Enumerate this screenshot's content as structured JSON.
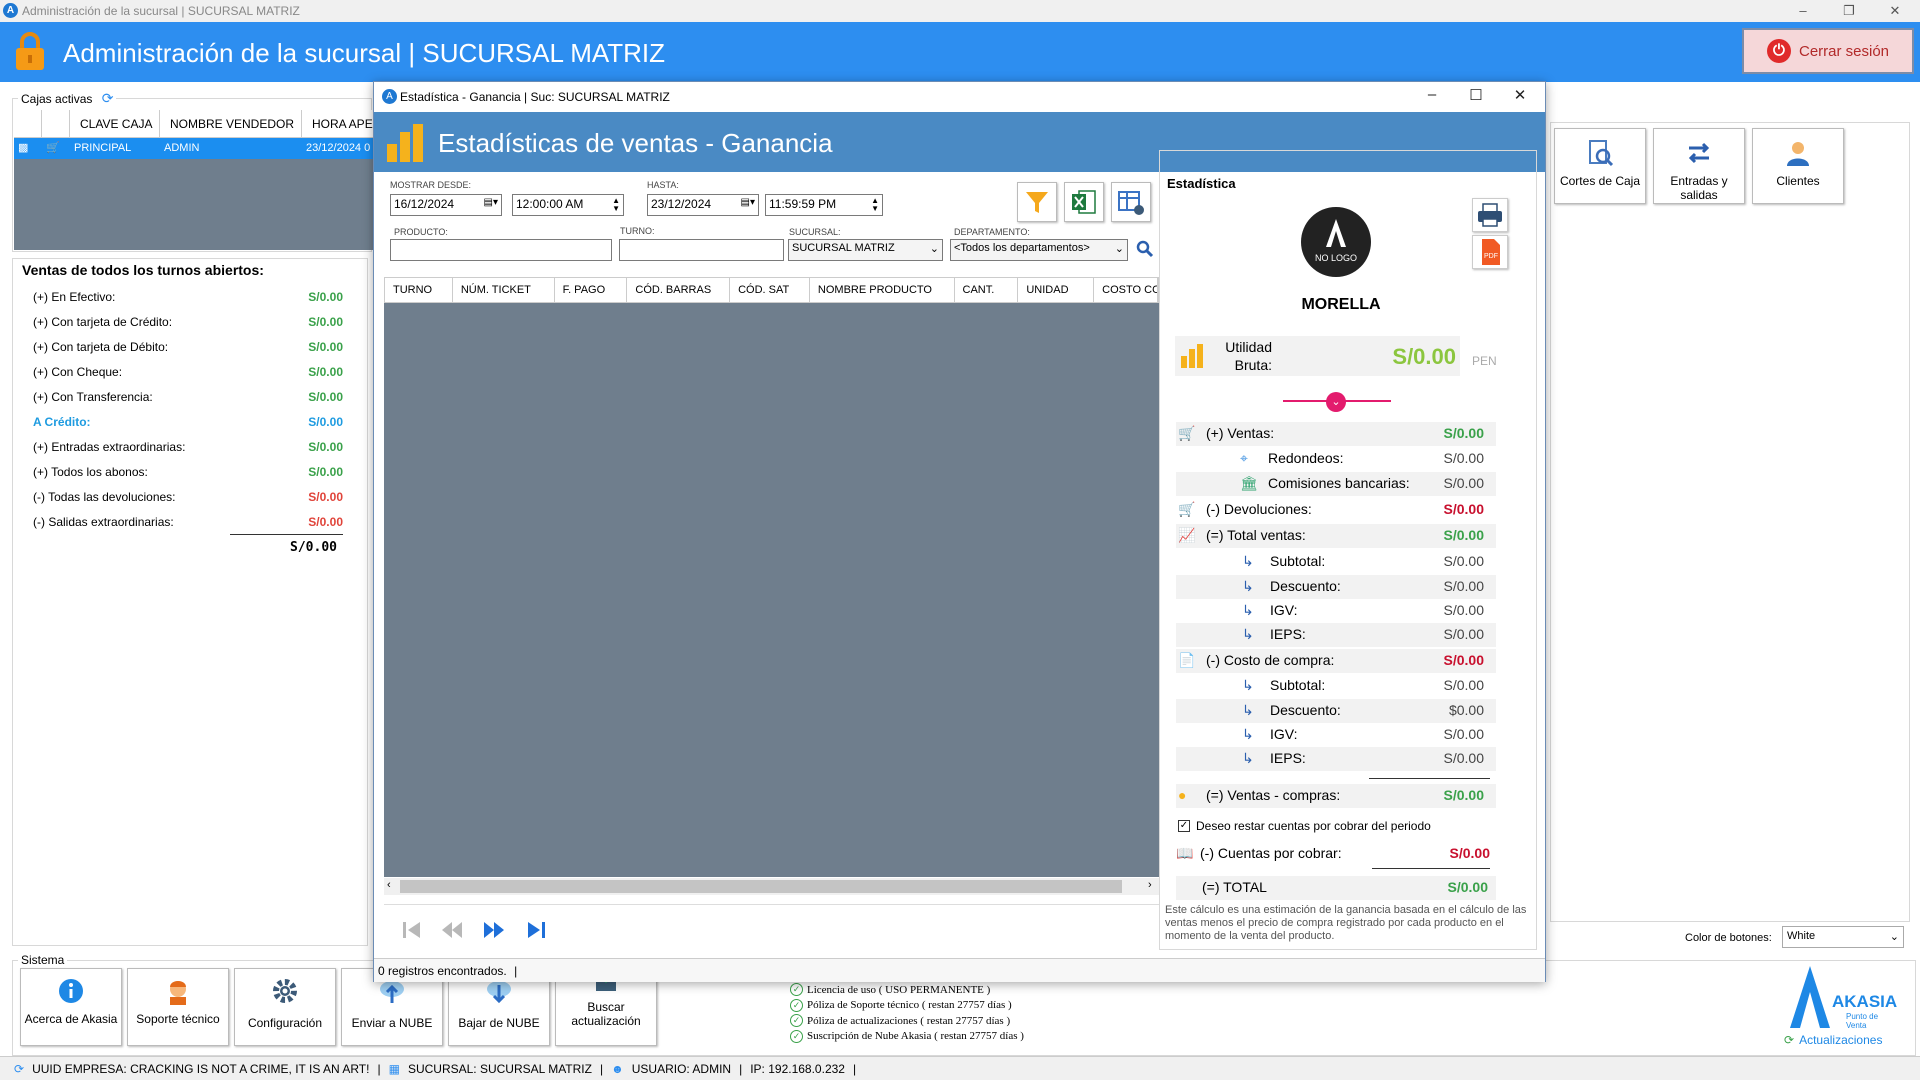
{
  "window": {
    "title": "Administración de la sucursal | SUCURSAL MATRIZ"
  },
  "header": {
    "title": "Administración de la sucursal | SUCURSAL MATRIZ",
    "logout_label": "Cerrar sesión"
  },
  "cajas": {
    "caption": "Cajas activas",
    "columns": [
      "CLAVE CAJA",
      "NOMBRE VENDEDOR",
      "HORA APERTURA"
    ],
    "rows": [
      {
        "clave": "PRINCIPAL",
        "vendedor": "ADMIN",
        "hora": "23/12/2024 0"
      }
    ]
  },
  "ventas": {
    "title": "Ventas de todos los turnos abiertos:",
    "rows": [
      {
        "label": "(+) En Efectivo:",
        "value": "S/0.00"
      },
      {
        "label": "(+) Con tarjeta de Crédito:",
        "value": "S/0.00"
      },
      {
        "label": "(+) Con tarjeta de Débito:",
        "value": "S/0.00"
      },
      {
        "label": "(+) Con Cheque:",
        "value": "S/0.00"
      },
      {
        "label": "(+) Con Transferencia:",
        "value": "S/0.00"
      },
      {
        "label": "A Crédito:",
        "value": "S/0.00"
      },
      {
        "label": "(+) Entradas extraordinarias:",
        "value": "S/0.00"
      },
      {
        "label": "(+) Todos los abonos:",
        "value": "S/0.00"
      },
      {
        "label": "(-) Todas las devoluciones:",
        "value": "S/0.00"
      },
      {
        "label": "(-) Salidas extraordinarias:",
        "value": "S/0.00"
      }
    ],
    "total": "S/0.00"
  },
  "sistema": {
    "caption": "Sistema",
    "buttons": [
      "Acerca de Akasia",
      "Soporte técnico",
      "Configuración",
      "Enviar a NUBE",
      "Bajar de NUBE",
      "Buscar actualización"
    ],
    "licenses": [
      "Licencia de uso ( USO PERMANENTE )",
      "Póliza de Soporte técnico ( restan 27757 días )",
      "Póliza de actualizaciones ( restan 27757 días )",
      "Suscripción de Nube Akasia ( restan 27757 días )"
    ]
  },
  "right_buttons": [
    "Cortes de Caja",
    "Entradas y salidas",
    "Clientes"
  ],
  "color_botones": {
    "label": "Color de botones:",
    "value": "White"
  },
  "akasia": {
    "brand": "AKASIA",
    "sub": "Punto de Venta",
    "updates": "Actualizaciones"
  },
  "statusbar": {
    "empresa": "UUID EMPRESA: CRACKING IS NOT A CRIME, IT IS AN ART!",
    "sucursal": "SUCURSAL: SUCURSAL MATRIZ",
    "usuario": "USUARIO: ADMIN",
    "ip": "IP: 192.168.0.232"
  },
  "modal": {
    "window_title": "Estadística - Ganancia | Suc: SUCURSAL MATRIZ",
    "header_title": "Estadísticas de ventas - Ganancia",
    "filters": {
      "desde_label": "MOSTRAR DESDE:",
      "desde_date": "16/12/2024",
      "desde_time": "12:00:00 AM",
      "hasta_label": "HASTA:",
      "hasta_date": "23/12/2024",
      "hasta_time": "11:59:59 PM",
      "producto_label": "PRODUCTO:",
      "producto_value": "",
      "turno_label": "TURNO:",
      "turno_value": "",
      "sucursal_label": "SUCURSAL:",
      "sucursal_value": "SUCURSAL MATRIZ",
      "departamento_label": "DEPARTAMENTO:",
      "departamento_value": "<Todos los departamentos>"
    },
    "grid_columns": [
      "TURNO",
      "NÚM. TICKET",
      "F. PAGO",
      "CÓD. BARRAS",
      "CÓD. SAT",
      "NOMBRE PRODUCTO",
      "CANT.",
      "UNIDAD",
      "COSTO CO"
    ],
    "records": "0 registros encontrados.",
    "records_sep": "|"
  },
  "estadistica": {
    "caption": "Estadística",
    "logo_text": "NO LOGO",
    "company": "MORELLA",
    "utilidad_label": "Utilidad Bruta:",
    "utilidad_value": "S/0.00",
    "currency": "PEN",
    "rows": [
      {
        "label": "(+) Ventas:",
        "value": "S/0.00",
        "color": "#3aa14a"
      },
      {
        "label": "Redondeos:",
        "value": "S/0.00",
        "color": "#444"
      },
      {
        "label": "Comisiones bancarias:",
        "value": "S/0.00",
        "color": "#444"
      },
      {
        "label": "(-) Devoluciones:",
        "value": "S/0.00",
        "color": "#c8102e"
      },
      {
        "label": "(=) Total ventas:",
        "value": "S/0.00",
        "color": "#3aa14a"
      },
      {
        "label": "Subtotal:",
        "value": "S/0.00",
        "color": "#444"
      },
      {
        "label": "Descuento:",
        "value": "S/0.00",
        "color": "#444"
      },
      {
        "label": "IGV:",
        "value": "S/0.00",
        "color": "#444"
      },
      {
        "label": "IEPS:",
        "value": "S/0.00",
        "color": "#444"
      },
      {
        "label": "(-) Costo de compra:",
        "value": "S/0.00",
        "color": "#c8102e"
      },
      {
        "label": "Subtotal:",
        "value": "S/0.00",
        "color": "#444"
      },
      {
        "label": "Descuento:",
        "value": "$0.00",
        "color": "#444"
      },
      {
        "label": "IGV:",
        "value": "S/0.00",
        "color": "#444"
      },
      {
        "label": "IEPS:",
        "value": "S/0.00",
        "color": "#444"
      },
      {
        "label": "(=) Ventas - compras:",
        "value": "S/0.00",
        "color": "#3aa14a"
      }
    ],
    "checkbox_label": "Deseo restar cuentas por cobrar del periodo",
    "cuentas_label": "(-) Cuentas por cobrar:",
    "cuentas_value": "S/0.00",
    "total_label": "(=) TOTAL",
    "total_value": "S/0.00",
    "note": "Este cálculo es una estimación de la ganancia basada en el cálculo de las ventas menos el precio de compra registrado por cada producto en el momento de la venta del producto."
  }
}
